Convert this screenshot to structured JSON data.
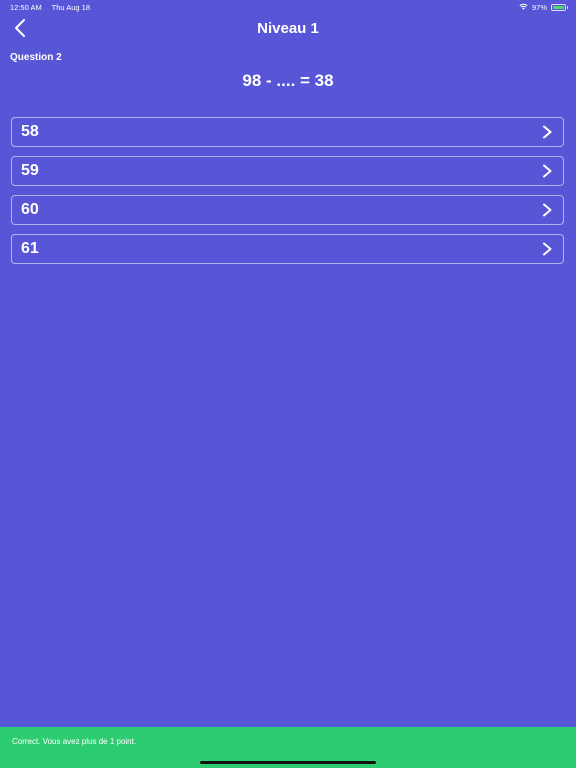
{
  "status_bar": {
    "time": "12:50 AM",
    "date": "Thu Aug 18",
    "battery": "97%",
    "battery_level": 0.97,
    "icons": [
      "wifi-icon",
      "battery-icon"
    ]
  },
  "nav": {
    "title": "Niveau 1",
    "back_icon": "chevron-left-icon"
  },
  "question": {
    "label": "Question 2",
    "equation": "98 - .... = 38"
  },
  "options": [
    {
      "label": "58"
    },
    {
      "label": "59"
    },
    {
      "label": "60"
    },
    {
      "label": "61"
    }
  ],
  "toast": {
    "message": "Correct. Vous avez plus de 1 point."
  },
  "colors": {
    "background": "#5856D6",
    "toast": "#2ECC71",
    "text": "#FFFFFF"
  }
}
